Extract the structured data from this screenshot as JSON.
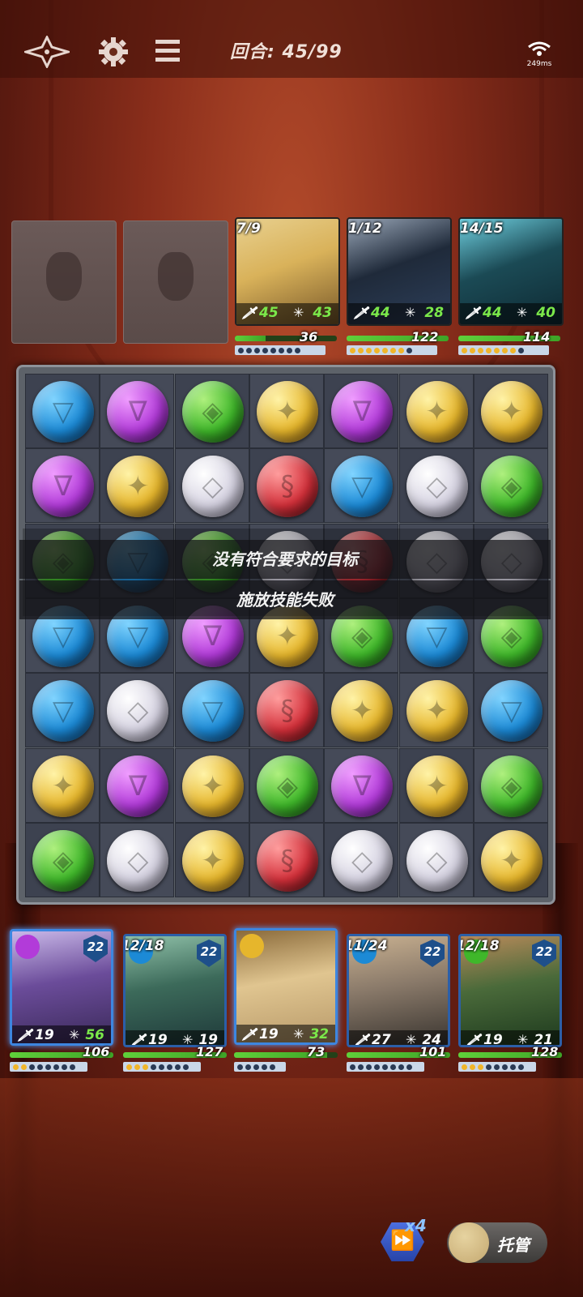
{
  "topbar": {
    "turn_text": "回合: 45/99",
    "ping_text": "249ms",
    "icons": [
      "back-sparkle-icon",
      "gear-icon",
      "menu-icon",
      "wifi-icon"
    ]
  },
  "enemies": [
    {
      "counter": "7/9",
      "atk": "45",
      "def": "43",
      "hp": "36",
      "hp_fraction": 0.3,
      "charge_on": 0,
      "charge_total": 8,
      "colors": [
        "#d9b25a",
        "#7a5a2a",
        "#e8d08f"
      ]
    },
    {
      "counter": "1/12",
      "atk": "44",
      "def": "28",
      "hp": "122",
      "hp_fraction": 1.0,
      "charge_on": 7,
      "charge_total": 8,
      "colors": [
        "#1f2a3a",
        "#2d3f5a",
        "#9aa7b8"
      ]
    },
    {
      "counter": "14/15",
      "atk": "44",
      "def": "40",
      "hp": "114",
      "hp_fraction": 1.0,
      "charge_on": 7,
      "charge_total": 8,
      "colors": [
        "#1b4a55",
        "#0e2a33",
        "#6fd0e0"
      ]
    }
  ],
  "board": {
    "rows": [
      [
        "blue",
        "purple",
        "green",
        "yellow",
        "purple",
        "yellow",
        "yellow"
      ],
      [
        "purple",
        "yellow",
        "white",
        "red",
        "blue",
        "white",
        "green"
      ],
      [
        "green",
        "blue",
        "green",
        "white",
        "red",
        "white",
        "white"
      ],
      [
        "blue",
        "blue",
        "purple",
        "yellow",
        "green",
        "blue",
        "green"
      ],
      [
        "blue",
        "white",
        "blue",
        "red",
        "yellow",
        "yellow",
        "blue"
      ],
      [
        "yellow",
        "purple",
        "yellow",
        "green",
        "purple",
        "yellow",
        "green"
      ],
      [
        "green",
        "white",
        "yellow",
        "red",
        "white",
        "white",
        "yellow"
      ]
    ],
    "message_line1": "没有符合要求的目标",
    "message_line2": "施放技能失败"
  },
  "heroes": [
    {
      "counter": "",
      "level": "22",
      "atk": "19",
      "def": "56",
      "hp": "106",
      "hp_fraction": 1.0,
      "charge_on": 2,
      "charge_total": 8,
      "element": "purple",
      "highlight": true,
      "colors": [
        "#3b2a5a",
        "#6b4c9a",
        "#c9b8e8"
      ]
    },
    {
      "counter": "12/18",
      "level": "22",
      "atk": "19",
      "def": "19",
      "hp": "127",
      "hp_fraction": 1.0,
      "charge_on": 3,
      "charge_total": 8,
      "element": "blue",
      "highlight": false,
      "colors": [
        "#1f3a3a",
        "#3c6a5a",
        "#8fc0a8"
      ]
    },
    {
      "counter": "",
      "level": "",
      "atk": "19",
      "def": "32",
      "hp": "73",
      "hp_fraction": 0.9,
      "charge_on": 0,
      "charge_total": 5,
      "element": "yellow",
      "highlight": true,
      "colors": [
        "#b89a6a",
        "#e0c590",
        "#8a6a3a"
      ]
    },
    {
      "counter": "11/24",
      "level": "22",
      "atk": "27",
      "def": "24",
      "hp": "101",
      "hp_fraction": 1.0,
      "charge_on": 0,
      "charge_total": 8,
      "element": "blue",
      "highlight": false,
      "colors": [
        "#3a3530",
        "#8a7a6a",
        "#c8b090"
      ]
    },
    {
      "counter": "12/18",
      "level": "22",
      "atk": "19",
      "def": "21",
      "hp": "128",
      "hp_fraction": 1.0,
      "charge_on": 3,
      "charge_total": 8,
      "element": "green",
      "highlight": false,
      "colors": [
        "#1e3a1e",
        "#4a6a3a",
        "#b88a5a"
      ]
    }
  ],
  "controls": {
    "speed_label": "x4",
    "auto_label": "托管"
  }
}
